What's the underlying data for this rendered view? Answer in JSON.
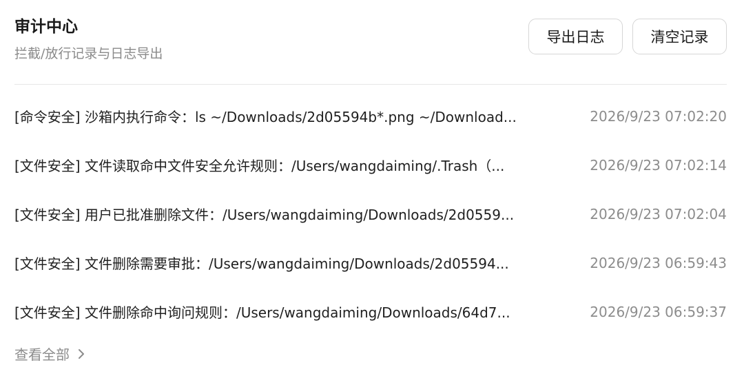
{
  "header": {
    "title": "审计中心",
    "subtitle": "拦截/放行记录与日志导出",
    "export_label": "导出日志",
    "clear_label": "清空记录"
  },
  "logs": [
    {
      "message": "[命令安全] 沙箱内执行命令：ls ~/Downloads/2d05594b*.png ~/Download...",
      "time": "2026/9/23 07:02:20"
    },
    {
      "message": "[文件安全] 文件读取命中文件安全允许规则：/Users/wangdaiming/.Trash（...",
      "time": "2026/9/23 07:02:14"
    },
    {
      "message": "[文件安全] 用户已批准删除文件：/Users/wangdaiming/Downloads/2d0559...",
      "time": "2026/9/23 07:02:04"
    },
    {
      "message": "[文件安全] 文件删除需要审批：/Users/wangdaiming/Downloads/2d05594...",
      "time": "2026/9/23 06:59:43"
    },
    {
      "message": "[文件安全] 文件删除命中询问规则：/Users/wangdaiming/Downloads/64d7...",
      "time": "2026/9/23 06:59:37"
    }
  ],
  "footer": {
    "view_all_label": "查看全部",
    "view_all_icon": "chevron-right-icon"
  }
}
